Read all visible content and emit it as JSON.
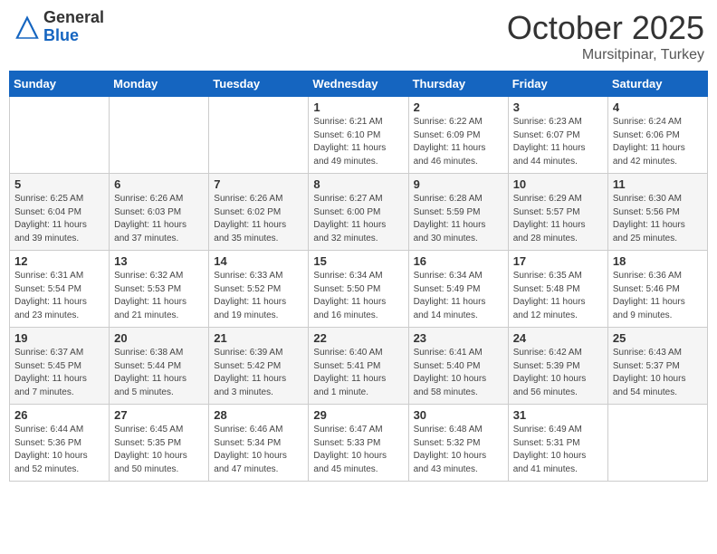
{
  "header": {
    "logo_general": "General",
    "logo_blue": "Blue",
    "month": "October 2025",
    "location": "Mursitpinar, Turkey"
  },
  "days_of_week": [
    "Sunday",
    "Monday",
    "Tuesday",
    "Wednesday",
    "Thursday",
    "Friday",
    "Saturday"
  ],
  "weeks": [
    [
      {
        "day": "",
        "content": ""
      },
      {
        "day": "",
        "content": ""
      },
      {
        "day": "",
        "content": ""
      },
      {
        "day": "1",
        "content": "Sunrise: 6:21 AM\nSunset: 6:10 PM\nDaylight: 11 hours\nand 49 minutes."
      },
      {
        "day": "2",
        "content": "Sunrise: 6:22 AM\nSunset: 6:09 PM\nDaylight: 11 hours\nand 46 minutes."
      },
      {
        "day": "3",
        "content": "Sunrise: 6:23 AM\nSunset: 6:07 PM\nDaylight: 11 hours\nand 44 minutes."
      },
      {
        "day": "4",
        "content": "Sunrise: 6:24 AM\nSunset: 6:06 PM\nDaylight: 11 hours\nand 42 minutes."
      }
    ],
    [
      {
        "day": "5",
        "content": "Sunrise: 6:25 AM\nSunset: 6:04 PM\nDaylight: 11 hours\nand 39 minutes."
      },
      {
        "day": "6",
        "content": "Sunrise: 6:26 AM\nSunset: 6:03 PM\nDaylight: 11 hours\nand 37 minutes."
      },
      {
        "day": "7",
        "content": "Sunrise: 6:26 AM\nSunset: 6:02 PM\nDaylight: 11 hours\nand 35 minutes."
      },
      {
        "day": "8",
        "content": "Sunrise: 6:27 AM\nSunset: 6:00 PM\nDaylight: 11 hours\nand 32 minutes."
      },
      {
        "day": "9",
        "content": "Sunrise: 6:28 AM\nSunset: 5:59 PM\nDaylight: 11 hours\nand 30 minutes."
      },
      {
        "day": "10",
        "content": "Sunrise: 6:29 AM\nSunset: 5:57 PM\nDaylight: 11 hours\nand 28 minutes."
      },
      {
        "day": "11",
        "content": "Sunrise: 6:30 AM\nSunset: 5:56 PM\nDaylight: 11 hours\nand 25 minutes."
      }
    ],
    [
      {
        "day": "12",
        "content": "Sunrise: 6:31 AM\nSunset: 5:54 PM\nDaylight: 11 hours\nand 23 minutes."
      },
      {
        "day": "13",
        "content": "Sunrise: 6:32 AM\nSunset: 5:53 PM\nDaylight: 11 hours\nand 21 minutes."
      },
      {
        "day": "14",
        "content": "Sunrise: 6:33 AM\nSunset: 5:52 PM\nDaylight: 11 hours\nand 19 minutes."
      },
      {
        "day": "15",
        "content": "Sunrise: 6:34 AM\nSunset: 5:50 PM\nDaylight: 11 hours\nand 16 minutes."
      },
      {
        "day": "16",
        "content": "Sunrise: 6:34 AM\nSunset: 5:49 PM\nDaylight: 11 hours\nand 14 minutes."
      },
      {
        "day": "17",
        "content": "Sunrise: 6:35 AM\nSunset: 5:48 PM\nDaylight: 11 hours\nand 12 minutes."
      },
      {
        "day": "18",
        "content": "Sunrise: 6:36 AM\nSunset: 5:46 PM\nDaylight: 11 hours\nand 9 minutes."
      }
    ],
    [
      {
        "day": "19",
        "content": "Sunrise: 6:37 AM\nSunset: 5:45 PM\nDaylight: 11 hours\nand 7 minutes."
      },
      {
        "day": "20",
        "content": "Sunrise: 6:38 AM\nSunset: 5:44 PM\nDaylight: 11 hours\nand 5 minutes."
      },
      {
        "day": "21",
        "content": "Sunrise: 6:39 AM\nSunset: 5:42 PM\nDaylight: 11 hours\nand 3 minutes."
      },
      {
        "day": "22",
        "content": "Sunrise: 6:40 AM\nSunset: 5:41 PM\nDaylight: 11 hours\nand 1 minute."
      },
      {
        "day": "23",
        "content": "Sunrise: 6:41 AM\nSunset: 5:40 PM\nDaylight: 10 hours\nand 58 minutes."
      },
      {
        "day": "24",
        "content": "Sunrise: 6:42 AM\nSunset: 5:39 PM\nDaylight: 10 hours\nand 56 minutes."
      },
      {
        "day": "25",
        "content": "Sunrise: 6:43 AM\nSunset: 5:37 PM\nDaylight: 10 hours\nand 54 minutes."
      }
    ],
    [
      {
        "day": "26",
        "content": "Sunrise: 6:44 AM\nSunset: 5:36 PM\nDaylight: 10 hours\nand 52 minutes."
      },
      {
        "day": "27",
        "content": "Sunrise: 6:45 AM\nSunset: 5:35 PM\nDaylight: 10 hours\nand 50 minutes."
      },
      {
        "day": "28",
        "content": "Sunrise: 6:46 AM\nSunset: 5:34 PM\nDaylight: 10 hours\nand 47 minutes."
      },
      {
        "day": "29",
        "content": "Sunrise: 6:47 AM\nSunset: 5:33 PM\nDaylight: 10 hours\nand 45 minutes."
      },
      {
        "day": "30",
        "content": "Sunrise: 6:48 AM\nSunset: 5:32 PM\nDaylight: 10 hours\nand 43 minutes."
      },
      {
        "day": "31",
        "content": "Sunrise: 6:49 AM\nSunset: 5:31 PM\nDaylight: 10 hours\nand 41 minutes."
      },
      {
        "day": "",
        "content": ""
      }
    ]
  ]
}
